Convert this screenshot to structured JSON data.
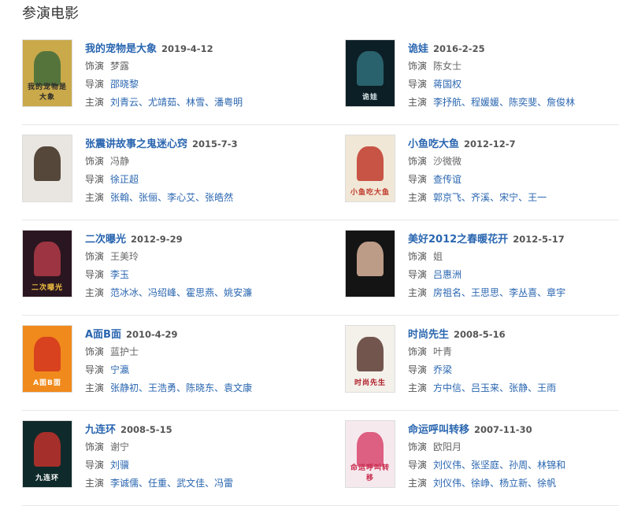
{
  "section_title": "参演电影",
  "labels": {
    "role": "饰演",
    "director": "导演",
    "cast": "主演"
  },
  "films": [
    {
      "title": "我的宠物是大象",
      "date": "2019-4-12",
      "role": "梦露",
      "director": [
        "邵晓黎"
      ],
      "cast": [
        "刘青云",
        "尤靖茹",
        "林雪",
        "潘粤明"
      ],
      "poster": {
        "bg": "#c9a94a",
        "accent": "#3f6b3a",
        "text": "我的宠物是大象",
        "text_color": "#2a2a2a"
      }
    },
    {
      "title": "诡娃",
      "date": "2016-2-25",
      "role": "陈女士",
      "director": [
        "蒋国权"
      ],
      "cast": [
        "李抒航",
        "程媛媛",
        "陈奕斐",
        "詹俊林"
      ],
      "poster": {
        "bg": "#0d1f26",
        "accent": "#2f6f7a",
        "text": "诡娃",
        "text_color": "#d8e6e8"
      }
    },
    {
      "title": "张震讲故事之鬼迷心窍",
      "date": "2015-7-3",
      "role": "冯静",
      "director": [
        "徐正超"
      ],
      "cast": [
        "张翰",
        "张俪",
        "李心艾",
        "张皓然"
      ],
      "poster": {
        "bg": "#e9e6e1",
        "accent": "#3b2a1c",
        "text": "",
        "text_color": "#333333"
      }
    },
    {
      "title": "小鱼吃大鱼",
      "date": "2012-12-7",
      "role": "沙微微",
      "director": [
        "查传谊"
      ],
      "cast": [
        "郭京飞",
        "齐溪",
        "宋宁",
        "王一"
      ],
      "poster": {
        "bg": "#f1e7d6",
        "accent": "#c0392b",
        "text": "小鱼吃大鱼",
        "text_color": "#c0392b"
      }
    },
    {
      "title": "二次曝光",
      "date": "2012-9-29",
      "role": "王美玲",
      "director": [
        "李玉"
      ],
      "cast": [
        "范冰冰",
        "冯绍峰",
        "霍思燕",
        "姚安濂"
      ],
      "poster": {
        "bg": "#2a1620",
        "accent": "#b03a48",
        "text": "二次曝光",
        "text_color": "#f0c040"
      }
    },
    {
      "title": "美好2012之春暖花开",
      "date": "2012-5-17",
      "role": "姐",
      "director": [
        "吕惠洲"
      ],
      "cast": [
        "房祖名",
        "王思思",
        "李丛喜",
        "章宇"
      ],
      "poster": {
        "bg": "#141414",
        "accent": "#d9b39b",
        "text": "",
        "text_color": "#ffffff"
      }
    },
    {
      "title": "A面B面",
      "date": "2010-4-29",
      "role": "蓝护士",
      "director": [
        "宁瀛"
      ],
      "cast": [
        "张静初",
        "王浩勇",
        "陈晓东",
        "袁文康"
      ],
      "poster": {
        "bg": "#f08a1c",
        "accent": "#d3351f",
        "text": "A面B面",
        "text_color": "#ffffff"
      }
    },
    {
      "title": "时尚先生",
      "date": "2008-5-16",
      "role": "叶青",
      "director": [
        "乔梁"
      ],
      "cast": [
        "方中信",
        "吕玉来",
        "张静",
        "王雨"
      ],
      "poster": {
        "bg": "#f4f0ea",
        "accent": "#5a3b32",
        "text": "时尚先生",
        "text_color": "#b0202a"
      }
    },
    {
      "title": "九连环",
      "date": "2008-5-15",
      "role": "谢宁",
      "director": [
        "刘骥"
      ],
      "cast": [
        "李诚儒",
        "任重",
        "武文佳",
        "冯雷"
      ],
      "poster": {
        "bg": "#0f2a2a",
        "accent": "#c0302a",
        "text": "九连环",
        "text_color": "#ffffff"
      }
    },
    {
      "title": "命运呼叫转移",
      "date": "2007-11-30",
      "role": "欧阳月",
      "director": [
        "刘仪伟",
        "张坚庭",
        "孙周",
        "林锦和"
      ],
      "cast": [
        "刘仪伟",
        "徐峥",
        "杨立新",
        "徐帆"
      ],
      "poster": {
        "bg": "#f6e9ee",
        "accent": "#d8476f",
        "text": "命运呼叫转移",
        "text_color": "#c8284a"
      }
    }
  ]
}
